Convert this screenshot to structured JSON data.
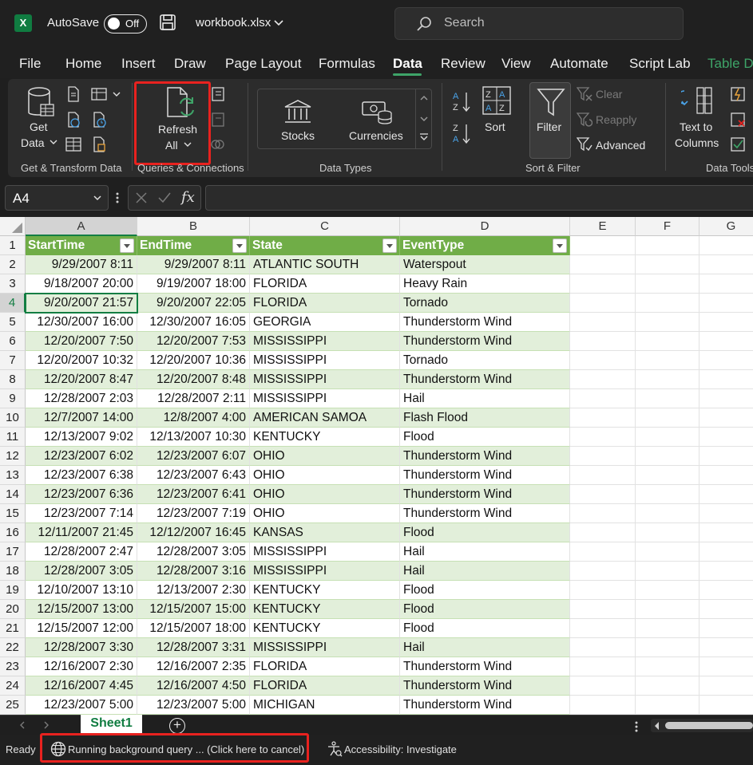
{
  "app": {
    "logo": "X",
    "autosave_label": "AutoSave",
    "autosave_state": "Off",
    "filename": "workbook.xlsx"
  },
  "search": {
    "placeholder": "Search"
  },
  "tabs": [
    "File",
    "Home",
    "Insert",
    "Draw",
    "Page Layout",
    "Formulas",
    "Data",
    "Review",
    "View",
    "Automate",
    "Script Lab",
    "Table D"
  ],
  "active_tab": "Data",
  "ribbon": {
    "get_data": [
      "Get",
      "Data"
    ],
    "refresh_all": [
      "Refresh",
      "All"
    ],
    "stocks": "Stocks",
    "currencies": "Currencies",
    "sort": "Sort",
    "filter": "Filter",
    "clear": "Clear",
    "reapply": "Reapply",
    "advanced": "Advanced",
    "text_to_columns": [
      "Text to",
      "Columns"
    ],
    "groups": {
      "get_transform": "Get & Transform Data",
      "queries": "Queries & Connections",
      "data_types": "Data Types",
      "sort_filter": "Sort & Filter",
      "data_tools": "Data Tools"
    }
  },
  "formula_bar": {
    "name_box": "A4",
    "fx": "fx",
    "value": ""
  },
  "columns": [
    "A",
    "B",
    "C",
    "D",
    "E",
    "F",
    "G"
  ],
  "table": {
    "headers": [
      "StartTime",
      "EndTime",
      "State",
      "EventType"
    ],
    "rows": [
      [
        "9/29/2007 8:11",
        "9/29/2007 8:11",
        "ATLANTIC SOUTH",
        "Waterspout"
      ],
      [
        "9/18/2007 20:00",
        "9/19/2007 18:00",
        "FLORIDA",
        "Heavy Rain"
      ],
      [
        "9/20/2007 21:57",
        "9/20/2007 22:05",
        "FLORIDA",
        "Tornado"
      ],
      [
        "12/30/2007 16:00",
        "12/30/2007 16:05",
        "GEORGIA",
        "Thunderstorm Wind"
      ],
      [
        "12/20/2007 7:50",
        "12/20/2007 7:53",
        "MISSISSIPPI",
        "Thunderstorm Wind"
      ],
      [
        "12/20/2007 10:32",
        "12/20/2007 10:36",
        "MISSISSIPPI",
        "Tornado"
      ],
      [
        "12/20/2007 8:47",
        "12/20/2007 8:48",
        "MISSISSIPPI",
        "Thunderstorm Wind"
      ],
      [
        "12/28/2007 2:03",
        "12/28/2007 2:11",
        "MISSISSIPPI",
        "Hail"
      ],
      [
        "12/7/2007 14:00",
        "12/8/2007 4:00",
        "AMERICAN SAMOA",
        "Flash Flood"
      ],
      [
        "12/13/2007 9:02",
        "12/13/2007 10:30",
        "KENTUCKY",
        "Flood"
      ],
      [
        "12/23/2007 6:02",
        "12/23/2007 6:07",
        "OHIO",
        "Thunderstorm Wind"
      ],
      [
        "12/23/2007 6:38",
        "12/23/2007 6:43",
        "OHIO",
        "Thunderstorm Wind"
      ],
      [
        "12/23/2007 6:36",
        "12/23/2007 6:41",
        "OHIO",
        "Thunderstorm Wind"
      ],
      [
        "12/23/2007 7:14",
        "12/23/2007 7:19",
        "OHIO",
        "Thunderstorm Wind"
      ],
      [
        "12/11/2007 21:45",
        "12/12/2007 16:45",
        "KANSAS",
        "Flood"
      ],
      [
        "12/28/2007 2:47",
        "12/28/2007 3:05",
        "MISSISSIPPI",
        "Hail"
      ],
      [
        "12/28/2007 3:05",
        "12/28/2007 3:16",
        "MISSISSIPPI",
        "Hail"
      ],
      [
        "12/10/2007 13:10",
        "12/13/2007 2:30",
        "KENTUCKY",
        "Flood"
      ],
      [
        "12/15/2007 13:00",
        "12/15/2007 15:00",
        "KENTUCKY",
        "Flood"
      ],
      [
        "12/15/2007 12:00",
        "12/15/2007 18:00",
        "KENTUCKY",
        "Flood"
      ],
      [
        "12/28/2007 3:30",
        "12/28/2007 3:31",
        "MISSISSIPPI",
        "Hail"
      ],
      [
        "12/16/2007 2:30",
        "12/16/2007 2:35",
        "FLORIDA",
        "Thunderstorm Wind"
      ],
      [
        "12/16/2007 4:45",
        "12/16/2007 4:50",
        "FLORIDA",
        "Thunderstorm Wind"
      ],
      [
        "12/23/2007 5:00",
        "12/23/2007 5:00",
        "MICHIGAN",
        "Thunderstorm Wind"
      ]
    ]
  },
  "sheet": {
    "name": "Sheet1",
    "add": "+"
  },
  "status": {
    "ready": "Ready",
    "query": "Running background query ...  (Click here to cancel)",
    "accessibility": "Accessibility: Investigate"
  },
  "colors": {
    "accent": "#107c41",
    "table_header": "#70ad47",
    "band": "#e2efda",
    "highlight": "#e8221f"
  }
}
